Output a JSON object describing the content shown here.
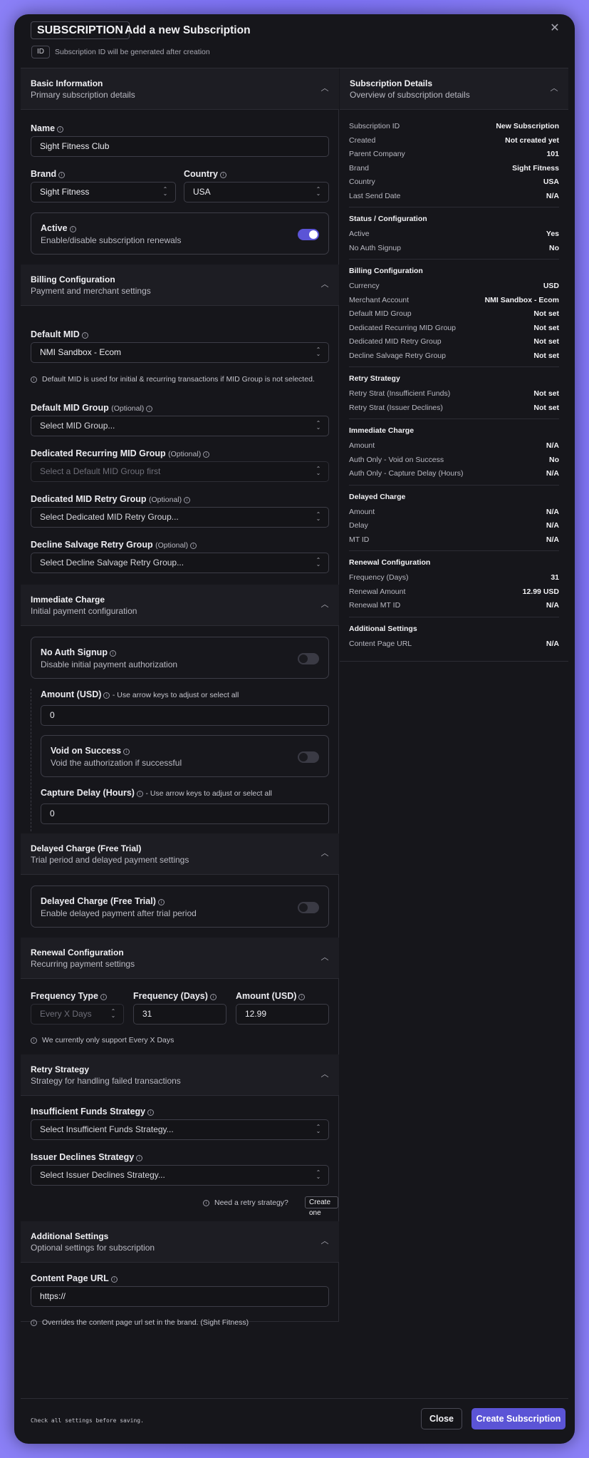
{
  "header": {
    "badge": "SUBSCRIPTION",
    "title": "Add a new Subscription",
    "id_badge": "ID",
    "id_note": "Subscription ID will be generated after creation",
    "close_glyph": "✕"
  },
  "basic": {
    "title": "Basic Information",
    "subtitle": "Primary subscription details",
    "name_label": "Name",
    "name_value": "Sight Fitness Club",
    "brand_label": "Brand",
    "brand_value": "Sight Fitness",
    "country_label": "Country",
    "country_value": "USA",
    "active_title": "Active",
    "active_sub": "Enable/disable subscription renewals",
    "active_on": true
  },
  "billing": {
    "title": "Billing Configuration",
    "subtitle": "Payment and merchant settings",
    "default_mid_label": "Default MID",
    "default_mid_value": "NMI Sandbox - Ecom",
    "default_mid_note": "Default MID is used for initial & recurring transactions if MID Group is not selected.",
    "mid_group_label": "Default MID Group",
    "mid_group_placeholder": "Select MID Group...",
    "recurring_label": "Dedicated Recurring MID Group",
    "recurring_placeholder": "Select a Default MID Group first",
    "retry_label": "Dedicated MID Retry Group",
    "retry_placeholder": "Select Dedicated MID Retry Group...",
    "salvage_label": "Decline Salvage Retry Group",
    "salvage_placeholder": "Select Decline Salvage Retry Group...",
    "optional": "(Optional)"
  },
  "immediate": {
    "title": "Immediate Charge",
    "subtitle": "Initial payment configuration",
    "noauth_title": "No Auth Signup",
    "noauth_sub": "Disable initial payment authorization",
    "amount_label": "Amount (USD)",
    "amount_hint": "- Use arrow keys to adjust or select all",
    "amount_value": "0",
    "void_title": "Void on Success",
    "void_sub": "Void the authorization if successful",
    "capture_label": "Capture Delay (Hours)",
    "capture_hint": "- Use arrow keys to adjust or select all",
    "capture_value": "0"
  },
  "delayed": {
    "title": "Delayed Charge (Free Trial)",
    "subtitle": "Trial period and delayed payment settings",
    "card_title": "Delayed Charge (Free Trial)",
    "card_sub": "Enable delayed payment after trial period"
  },
  "renewal": {
    "title": "Renewal Configuration",
    "subtitle": "Recurring payment settings",
    "freq_type_label": "Frequency Type",
    "freq_type_value": "Every X Days",
    "freq_days_label": "Frequency (Days)",
    "freq_days_value": "31",
    "amount_label": "Amount (USD)",
    "amount_value": "12.99",
    "note": "We currently only support Every X Days"
  },
  "retry": {
    "title": "Retry Strategy",
    "subtitle": "Strategy for handling failed transactions",
    "insufficient_label": "Insufficient Funds Strategy",
    "insufficient_placeholder": "Select Insufficient Funds Strategy...",
    "issuer_label": "Issuer Declines Strategy",
    "issuer_placeholder": "Select Issuer Declines Strategy...",
    "need_text": "Need a retry strategy?",
    "create_one": "Create one"
  },
  "additional": {
    "title": "Additional Settings",
    "subtitle": "Optional settings for subscription",
    "url_label": "Content Page URL",
    "url_value": "https://",
    "url_note": "Overrides the content page url set in the brand. (Sight Fitness)"
  },
  "summary": {
    "title": "Subscription Details",
    "subtitle": "Overview of subscription details",
    "groups": [
      {
        "title": "",
        "rows": [
          {
            "k": "Subscription ID",
            "v": "New Subscription"
          },
          {
            "k": "Created",
            "v": "Not created yet"
          },
          {
            "k": "Parent Company",
            "v": "101"
          },
          {
            "k": "Brand",
            "v": "Sight Fitness"
          },
          {
            "k": "Country",
            "v": "USA"
          },
          {
            "k": "Last Send Date",
            "v": "N/A"
          }
        ]
      },
      {
        "title": "Status / Configuration",
        "rows": [
          {
            "k": "Active",
            "v": "Yes"
          },
          {
            "k": "No Auth Signup",
            "v": "No"
          }
        ]
      },
      {
        "title": "Billing Configuration",
        "rows": [
          {
            "k": "Currency",
            "v": "USD"
          },
          {
            "k": "Merchant Account",
            "v": "NMI Sandbox - Ecom"
          },
          {
            "k": "Default MID Group",
            "v": "Not set"
          },
          {
            "k": "Dedicated Recurring MID Group",
            "v": "Not set"
          },
          {
            "k": "Dedicated MID Retry Group",
            "v": "Not set"
          },
          {
            "k": "Decline Salvage Retry Group",
            "v": "Not set"
          }
        ]
      },
      {
        "title": "Retry Strategy",
        "rows": [
          {
            "k": "Retry Strat (Insufficient Funds)",
            "v": "Not set"
          },
          {
            "k": "Retry Strat (Issuer Declines)",
            "v": "Not set"
          }
        ]
      },
      {
        "title": "Immediate Charge",
        "rows": [
          {
            "k": "Amount",
            "v": "N/A"
          },
          {
            "k": "Auth Only - Void on Success",
            "v": "No"
          },
          {
            "k": "Auth Only - Capture Delay (Hours)",
            "v": "N/A"
          }
        ]
      },
      {
        "title": "Delayed Charge",
        "rows": [
          {
            "k": "Amount",
            "v": "N/A"
          },
          {
            "k": "Delay",
            "v": "N/A"
          },
          {
            "k": "MT ID",
            "v": "N/A"
          }
        ]
      },
      {
        "title": "Renewal Configuration",
        "rows": [
          {
            "k": "Frequency (Days)",
            "v": "31"
          },
          {
            "k": "Renewal Amount",
            "v": "12.99 USD"
          },
          {
            "k": "Renewal MT ID",
            "v": "N/A"
          }
        ]
      },
      {
        "title": "Additional Settings",
        "rows": [
          {
            "k": "Content Page URL",
            "v": "N/A"
          }
        ]
      }
    ]
  },
  "footer": {
    "note": "Check all settings before saving.",
    "close": "Close",
    "create": "Create Subscription"
  },
  "colors": {
    "accent": "#5b54d6",
    "backdrop": "#7b6ff0",
    "panel": "#16161b"
  },
  "icons": {
    "info": "info-circle-icon",
    "chevron_up": "chevron-up-icon",
    "select": "select-arrows-icon",
    "close": "close-icon"
  }
}
